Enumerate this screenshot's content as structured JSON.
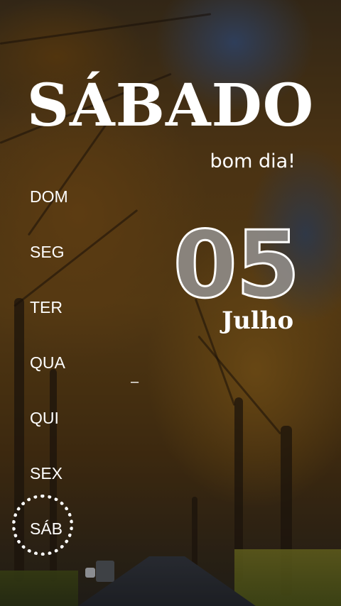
{
  "weekday_title": "SÁBADO",
  "greeting": "bom dia!",
  "days": [
    "DOM",
    "SEG",
    "TER",
    "QUA",
    "QUI",
    "SEX",
    "SÁB"
  ],
  "selected_day_index": 6,
  "date": {
    "day": "05",
    "month": "Julho"
  },
  "dash": "–",
  "colors": {
    "text": "#ffffff",
    "number_fill": "#8f8c88",
    "number_stroke": "#ffffff"
  }
}
